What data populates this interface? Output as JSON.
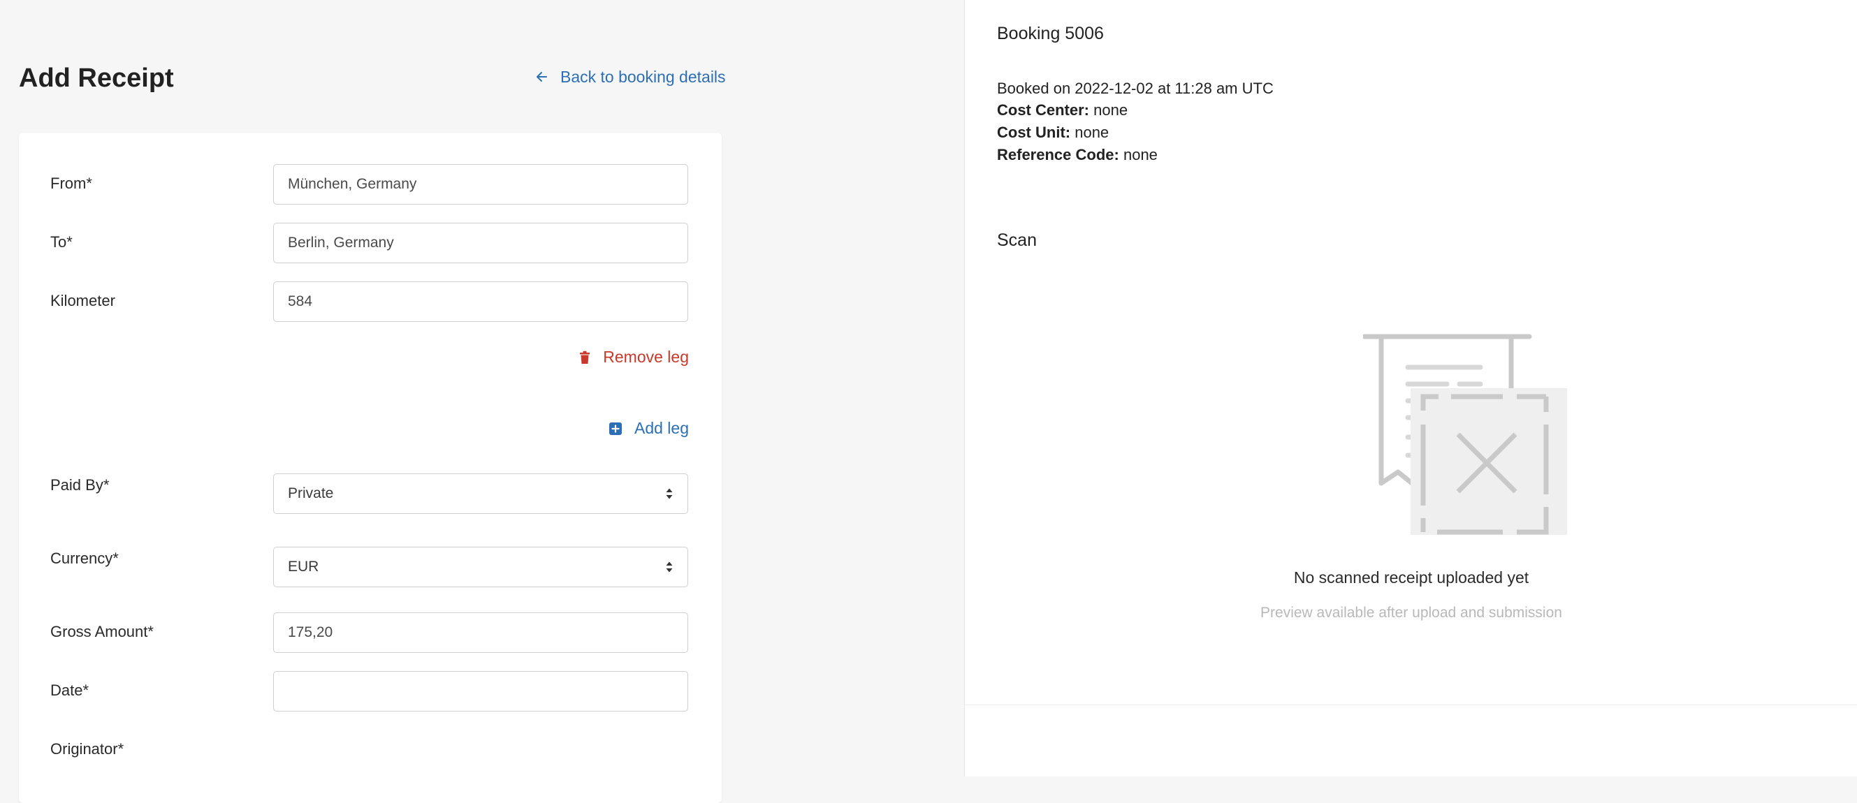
{
  "header": {
    "title": "Add Receipt",
    "back_link_label": "Back to booking details"
  },
  "form": {
    "from": {
      "label": "From*",
      "value": "München, Germany"
    },
    "to": {
      "label": "To*",
      "value": "Berlin, Germany"
    },
    "kilometer": {
      "label": "Kilometer",
      "value": "584"
    },
    "remove_leg_label": "Remove leg",
    "add_leg_label": "Add leg",
    "paid_by": {
      "label": "Paid By*",
      "value": "Private"
    },
    "currency": {
      "label": "Currency*",
      "value": "EUR"
    },
    "gross_amount": {
      "label": "Gross Amount*",
      "value": "175,20"
    },
    "date": {
      "label": "Date*",
      "value": ""
    },
    "originator": {
      "label": "Originator*"
    }
  },
  "booking": {
    "title": "Booking 5006",
    "booked_on": "Booked on 2022-12-02 at 11:28 am UTC",
    "cost_center_label": "Cost Center:",
    "cost_center_value": "none",
    "cost_unit_label": "Cost Unit:",
    "cost_unit_value": "none",
    "reference_code_label": "Reference Code:",
    "reference_code_value": "none"
  },
  "scan": {
    "title": "Scan",
    "empty_title": "No scanned receipt uploaded yet",
    "empty_subtitle": "Preview available after upload and submission",
    "illustration_icon": "receipt-missing-icon"
  },
  "colors": {
    "link_blue": "#2c6fb5",
    "danger_red": "#c8392b",
    "page_bg": "#f6f6f6"
  }
}
